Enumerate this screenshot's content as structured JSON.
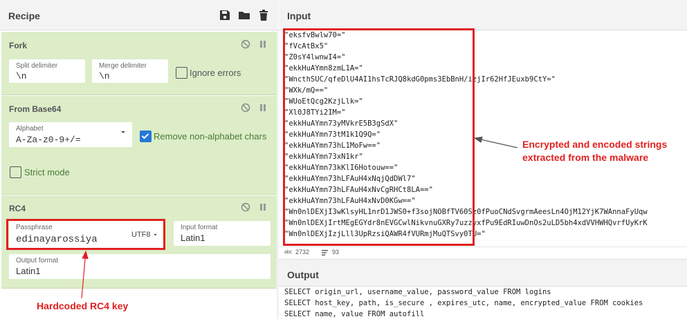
{
  "recipe": {
    "title": "Recipe",
    "header_icons": [
      "save-icon",
      "folder-icon",
      "trash-icon"
    ],
    "operations": {
      "fork": {
        "title": "Fork",
        "split_delimiter": {
          "label": "Split delimiter",
          "value": "\\n"
        },
        "merge_delimiter": {
          "label": "Merge delimiter",
          "value": "\\n"
        },
        "ignore_errors": {
          "label": "Ignore errors",
          "checked": false
        }
      },
      "from_base64": {
        "title": "From Base64",
        "alphabet": {
          "label": "Alphabet",
          "value": "A-Za-z0-9+/="
        },
        "remove_non_alphabet": {
          "label": "Remove non-alphabet chars",
          "checked": true
        },
        "strict_mode": {
          "label": "Strict mode",
          "checked": false
        }
      },
      "rc4": {
        "title": "RC4",
        "passphrase": {
          "label": "Passphrase",
          "value": "edinayarossiya",
          "encoding": "UTF8"
        },
        "input_format": {
          "label": "Input format",
          "value": "Latin1"
        },
        "output_format": {
          "label": "Output format",
          "value": "Latin1"
        }
      }
    }
  },
  "input": {
    "title": "Input",
    "lines": [
      "\"eksfvBwlw70=\"",
      "\"fVcAtBx5\"",
      "\"Z0sY4lwnwI4=\"",
      "\"ekkHuAYmn8zmL1A=\"",
      "\"WncthSUC/qfeDlU4AI1hsTcRJQ8kdG0pms3EbBnH/izjIr62HfJEuxb9CtY=\"",
      "\"WXk/mQ==\"",
      "\"WUoEtQcg2KzjLlk=\"",
      "\"Xl0J8TYi2IM=\"",
      "\"ekkHuAYmn73yMVkrE5B3gSdX\"",
      "\"ekkHuAYmn73tM1k1Q9Q=\"",
      "\"ekkHuAYmn73hL1MoFw==\"",
      "\"ekkHuAYmn73xN1kr\"",
      "\"ekkHuAYmn73kKlI6Hotouw==\"",
      "\"ekkHuAYmn73hLFAuH4xNqjQdDWl7\"",
      "\"ekkHuAYmn73hLFAuH4xNvCgRHCt8LA==\"",
      "\"ekkHuAYmn73hLFAuH4xNvD0KGw==\"",
      "\"Wn0nlDEXjI3wKlsyHL1nrD1JWS0+f3sojNOBfTV60Sz0fPuoCNdSvgrmAeesLn4OjM12YjK7WAnnaFyUqw",
      "\"Wn0nlDEXjIrtMEgEGYdr8nEVGCwlNikvnuGXRy7uzzyxfPu9EdRIuwDnOs2uLD5bh4xdVVHWHQvrfUyKrK",
      "\"Wn0nlDEXjIzjLll3UpRzsiQAWR4fVURmjMuQTSvy0TU=\""
    ],
    "status": {
      "chars": "2732",
      "lines": "93"
    }
  },
  "output": {
    "title": "Output",
    "lines": [
      "SELECT origin_url, username_value, password_value FROM logins",
      "SELECT host_key, path, is_secure , expires_utc, name, encrypted_value FROM cookies",
      "SELECT name, value FROM autofill"
    ]
  },
  "annotations": {
    "strings": "Encrypted and encoded strings extracted from the malware",
    "rc4_key": "Hardcoded RC4 key"
  },
  "colors": {
    "operation_bg": "#dcedc8",
    "annotation": "#e0201f",
    "checkbox_on": "#2477d6"
  }
}
